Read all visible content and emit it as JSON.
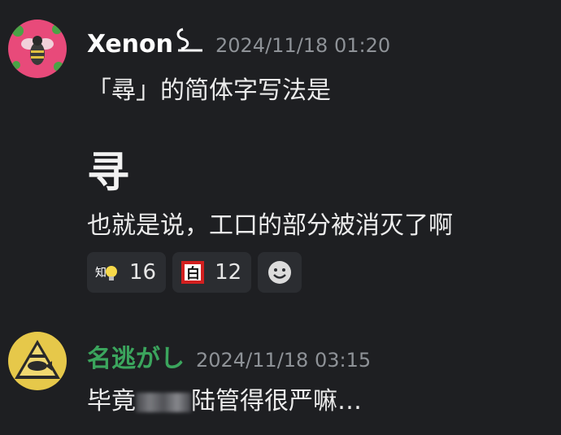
{
  "messages": [
    {
      "username": "Xenon",
      "username_color": "#ffffff",
      "timestamp": "2024/11/18 01:20",
      "avatar_icon": "bee-on-pink-avatar",
      "lines": [
        "「尋」的简体字写法是",
        "寻",
        "也就是说，工口的部分被消灭了啊"
      ],
      "reactions": [
        {
          "emoji": "lightbulb-emoji",
          "count": "16"
        },
        {
          "emoji": "bai-kanji-emoji",
          "count": "12"
        }
      ],
      "add_reaction_icon": "smile-add-reaction-icon"
    },
    {
      "username": "名逃がし",
      "username_color": "#3ba55d",
      "timestamp": "2024/11/18 03:15",
      "avatar_icon": "pyramid-fish-avatar",
      "lines": [
        "毕竟",
        "陆管得很严嘛…"
      ]
    }
  ]
}
